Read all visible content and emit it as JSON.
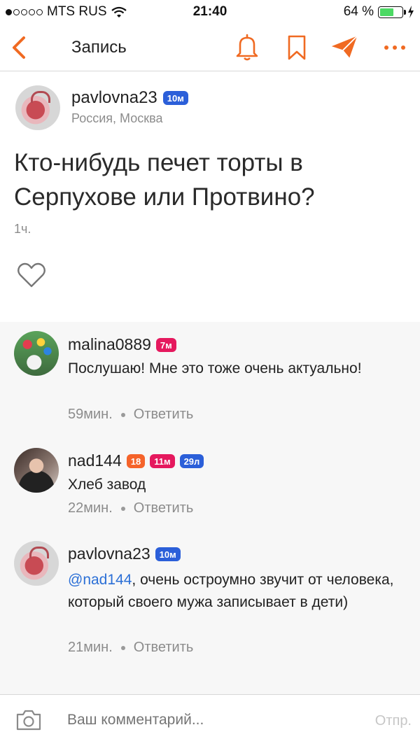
{
  "status_bar": {
    "carrier": "MTS RUS",
    "time": "21:40",
    "battery": "64 %",
    "battery_level": 0.64
  },
  "nav": {
    "title": "Запись",
    "icons": [
      "back-chevron-icon",
      "bell-icon",
      "bookmark-icon",
      "send-icon",
      "more-icon"
    ],
    "accent_color": "#f06a22"
  },
  "post": {
    "author": "pavlovna23",
    "badge": "10м",
    "badge_color": "#2b5fd9",
    "location": "Россия, Москва",
    "text": "Кто-нибудь печет торты в Серпухове или Протвино?",
    "time": "1ч."
  },
  "comments": [
    {
      "author": "malina0889",
      "badges": [
        {
          "label": "7м",
          "color": "#e5195e"
        }
      ],
      "text": "Послушаю! Мне это тоже очень актуально!",
      "time": "59мин.",
      "reply": "Ответить"
    },
    {
      "author": "nad144",
      "badges": [
        {
          "label": "18",
          "color": "#f5632a"
        },
        {
          "label": "11м",
          "color": "#e5195e"
        },
        {
          "label": "29л",
          "color": "#2b5fd9"
        }
      ],
      "text": "Хлеб завод",
      "time": "22мин.",
      "reply": "Ответить"
    },
    {
      "author": "pavlovna23",
      "badges": [
        {
          "label": "10м",
          "color": "#2b5fd9"
        }
      ],
      "mention": "@nad144",
      "text": ", очень остроумно звучит от человека, который своего мужа записывает в дети)",
      "time": "21мин.",
      "reply": "Ответить"
    }
  ],
  "footer": {
    "placeholder": "Ваш комментарий...",
    "send_label": "Отпр."
  }
}
